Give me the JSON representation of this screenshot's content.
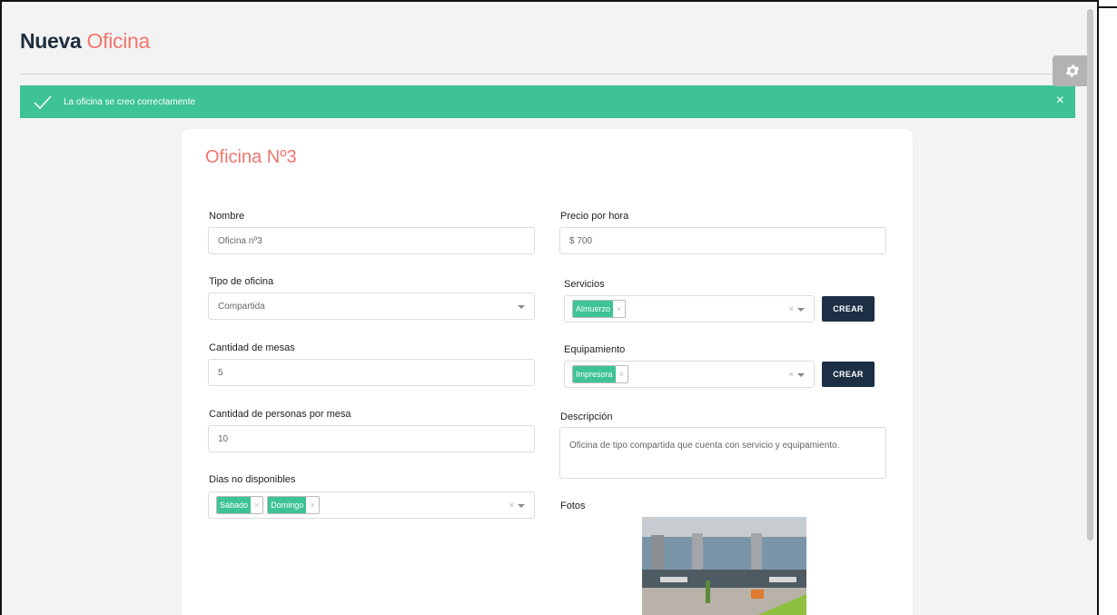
{
  "header": {
    "title_main": "Nueva",
    "title_accent": "Oficina"
  },
  "alert": {
    "message": "La oficina se creo correctamente",
    "close": "×"
  },
  "card": {
    "title": "Oficina Nº3"
  },
  "form": {
    "nombre": {
      "label": "Nombre",
      "value": "Oficina nº3"
    },
    "precio": {
      "label": "Precio por hora",
      "value": "$  700"
    },
    "tipo": {
      "label": "Tipo de oficina",
      "value": "Compartida"
    },
    "servicios": {
      "label": "Servicios",
      "tags": [
        "Almuerzo"
      ],
      "button": "CREAR"
    },
    "mesas": {
      "label": "Cantidad de mesas",
      "value": "5"
    },
    "equipamiento": {
      "label": "Equipamiento",
      "tags": [
        "Impresora"
      ],
      "button": "CREAR"
    },
    "personas": {
      "label": "Cantidad de personas por mesa",
      "value": "10"
    },
    "descripcion": {
      "label": "Descripción",
      "value": "Oficina de tipo compartida que cuenta con servicio y equipamiento."
    },
    "dias": {
      "label": "Dias no disponibles",
      "tags": [
        "Sábado",
        "Domingo"
      ]
    },
    "fotos": {
      "label": "Fotos"
    }
  },
  "icons": {
    "settings": "gear-icon",
    "alert": "check-icon",
    "remove": "×"
  },
  "colors": {
    "accent": "#f0766e",
    "success": "#3ec396",
    "button": "#1d2f45",
    "title": "#1f2d3d"
  }
}
